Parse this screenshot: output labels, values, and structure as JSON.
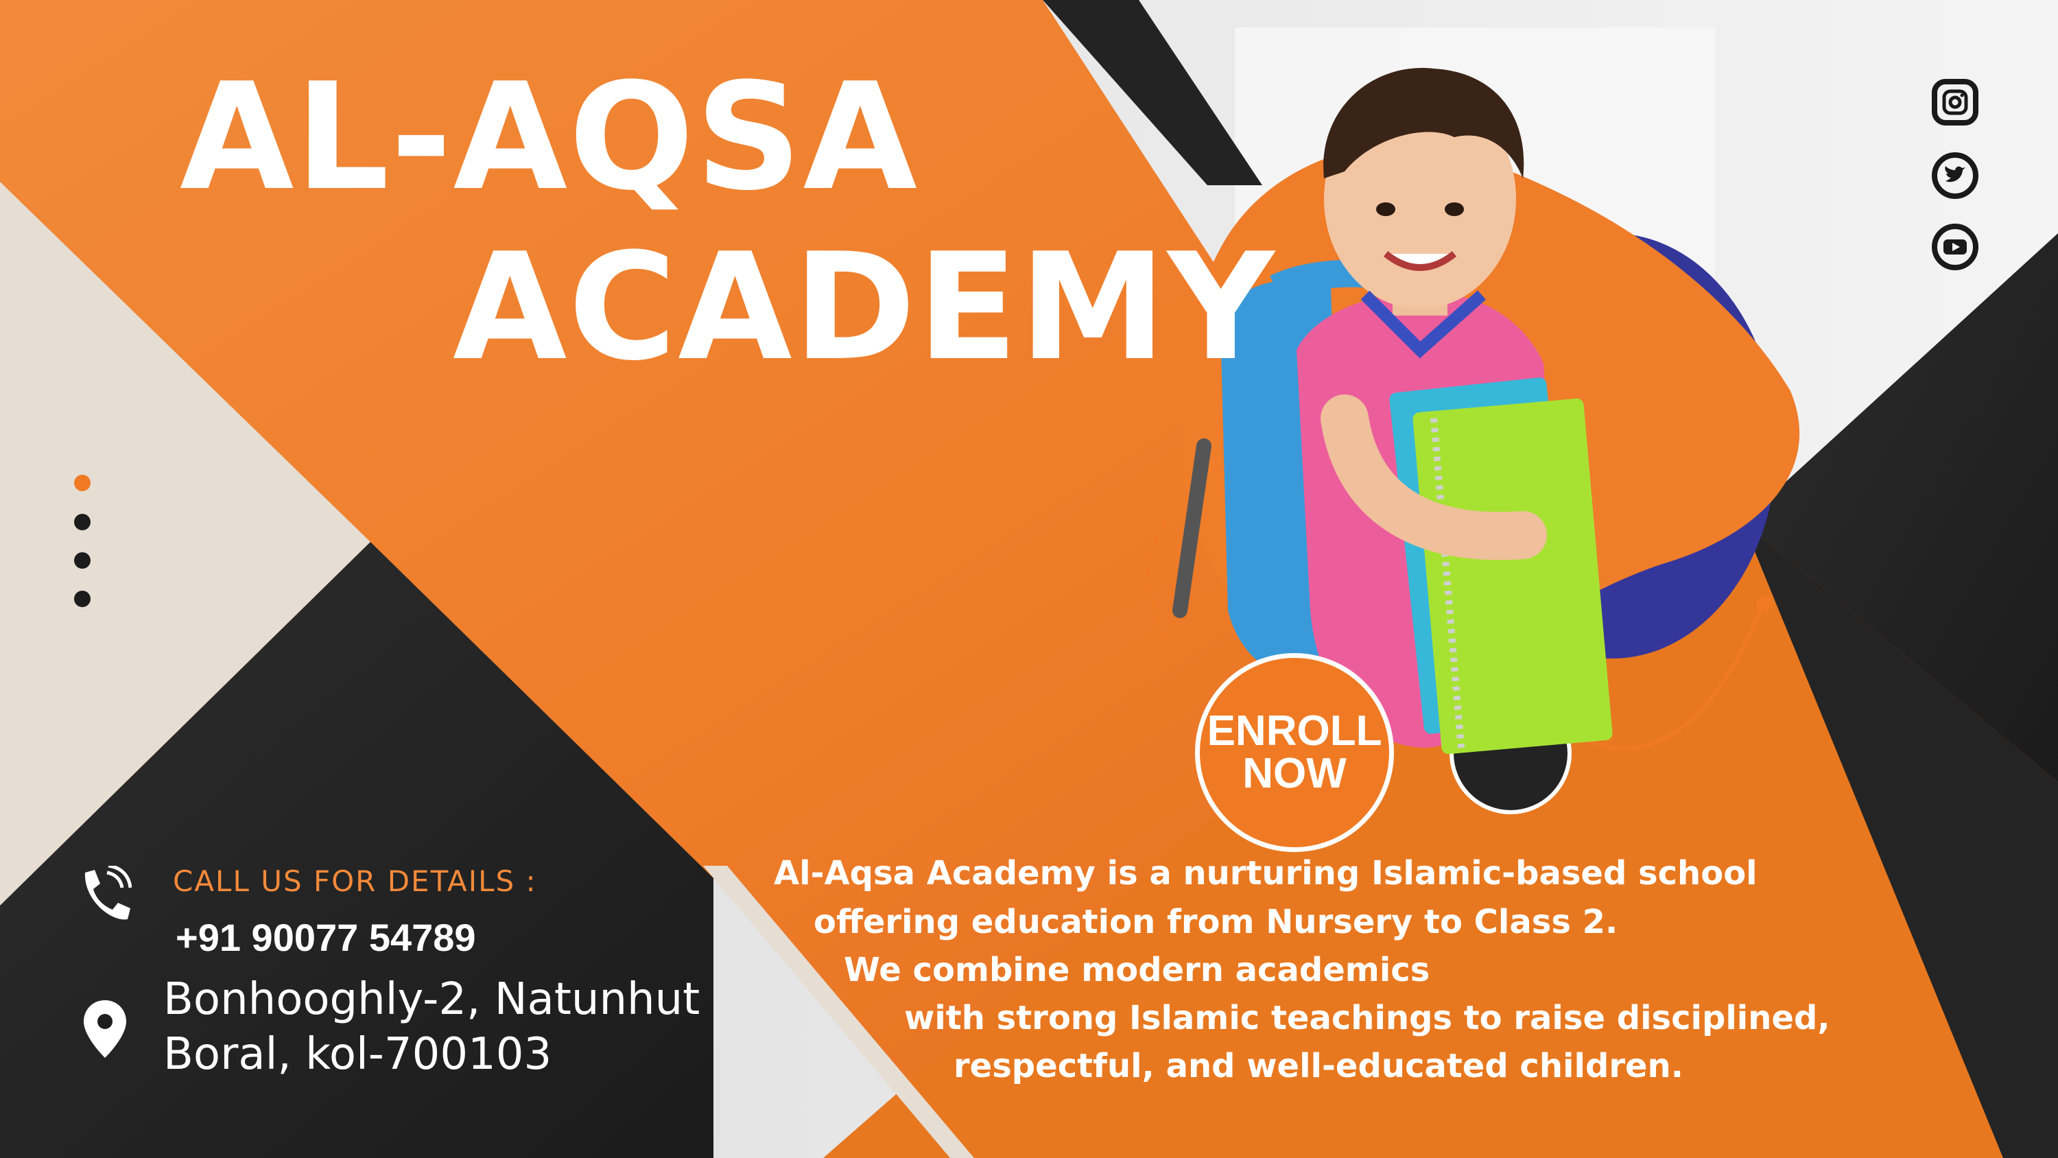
{
  "brand": {
    "title_line1": "AL-AQSA",
    "title_line2": "ACADEMY"
  },
  "cta": {
    "line1": "ENROLL",
    "line2": "NOW"
  },
  "social": [
    {
      "icon": "instagram-icon"
    },
    {
      "icon": "twitter-icon"
    },
    {
      "icon": "youtube-icon"
    }
  ],
  "contact": {
    "label": "CALL US FOR DETAILS :",
    "phone": "+91 90077 54789",
    "address_line1": "Bonhooghly-2, Natunhut",
    "address_line2": "Boral, kol-700103"
  },
  "description": {
    "line1": "Al-Aqsa Academy is a nurturing Islamic-based school",
    "line2": "offering education from Nursery to Class 2.",
    "line3": "We combine modern academics",
    "line4": "with strong Islamic teachings to raise disciplined,",
    "line5": "respectful, and well-educated children."
  },
  "colors": {
    "orange": "#f07a23",
    "dark": "#232323",
    "beige": "#e6ddd3",
    "navy": "#35369a",
    "white": "#ffffff"
  }
}
